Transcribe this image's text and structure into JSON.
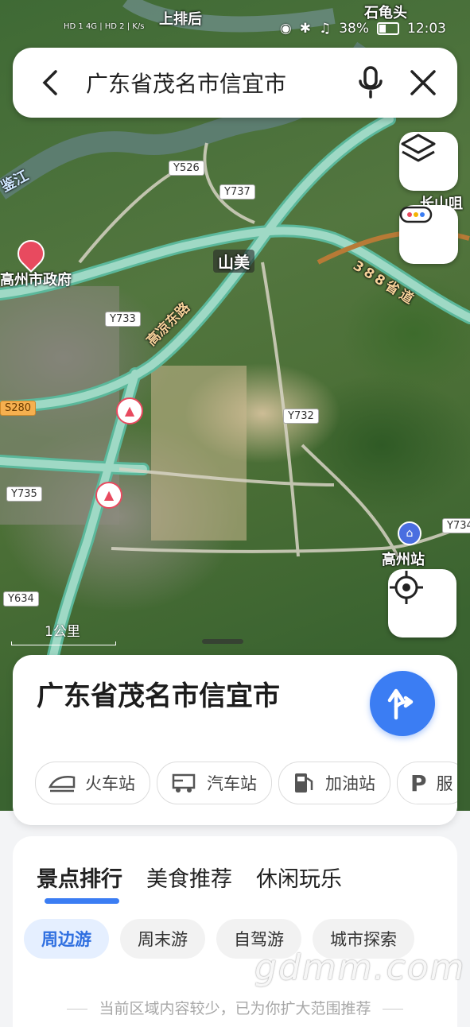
{
  "status_bar": {
    "top_place": "上排后",
    "top_right_place": "石龟头",
    "left_info": "HD 1 4G | HD 2 | K/s",
    "battery": "38%",
    "time": "12:03"
  },
  "search": {
    "query": "广东省茂名市信宜市"
  },
  "map": {
    "labels": {
      "shanmei": "山美",
      "gaozhou_gov": "高州市政府",
      "gaozhou_station": "高州站",
      "changshan": "长山咀",
      "jiang": "鉴江",
      "gaoliang_road": "高凉东路",
      "provincial_road": "388省道"
    },
    "road_tags": {
      "y526": "Y526",
      "y737": "Y737",
      "y733": "Y733",
      "y732": "Y732",
      "s280": "S280",
      "y735": "Y735",
      "y734": "Y734",
      "y634": "Y634"
    },
    "scale": "1公里",
    "colors": {
      "road_fill": "#9fd9c5",
      "road_edge": "#5bb89b",
      "accent_blue": "#3b7df3"
    }
  },
  "place_card": {
    "title": "广东省茂名市信宜市",
    "chips": [
      {
        "label": "火车站",
        "icon": "train-icon"
      },
      {
        "label": "汽车站",
        "icon": "bus-icon"
      },
      {
        "label": "加油站",
        "icon": "gas-station-icon"
      },
      {
        "label": "服",
        "icon": "parking-icon"
      }
    ]
  },
  "recommend": {
    "tabs": [
      "景点排行",
      "美食推荐",
      "休闲玩乐"
    ],
    "filters": [
      "周边游",
      "周末游",
      "自驾游",
      "城市探索"
    ],
    "footer": "当前区域内容较少，已为你扩大范围推荐",
    "watermark": "gdmm.com"
  }
}
